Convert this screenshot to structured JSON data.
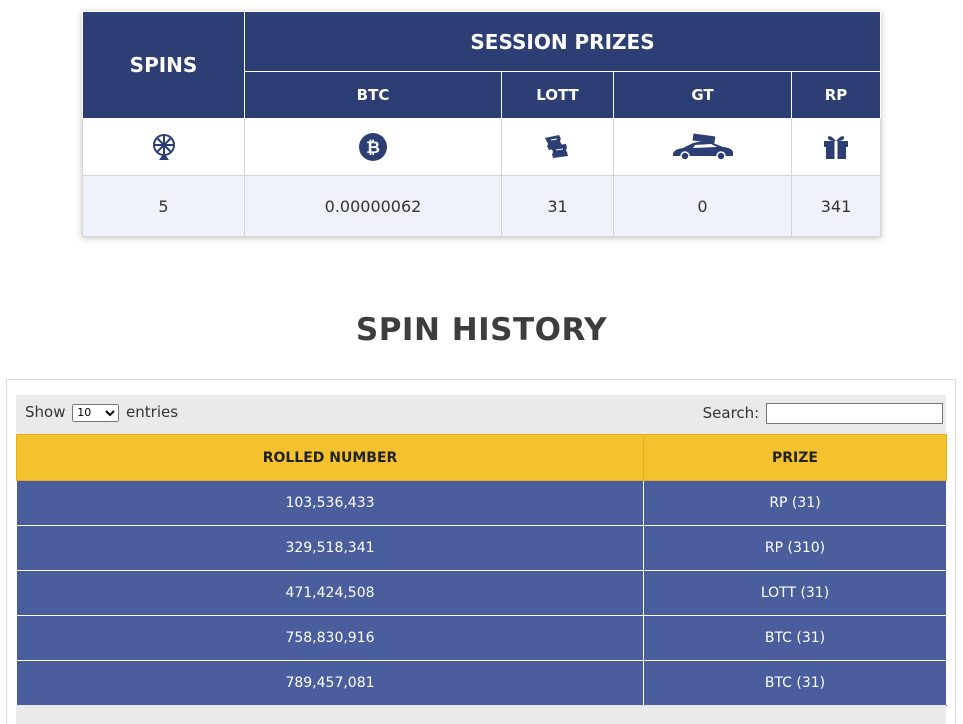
{
  "session": {
    "spins_header": "SPINS",
    "prizes_header": "SESSION PRIZES",
    "columns": [
      "BTC",
      "LOTT",
      "GT",
      "RP"
    ],
    "icons": [
      "wheel-icon",
      "bitcoin-icon",
      "tickets-icon",
      "car-icon",
      "gift-icon"
    ],
    "values": {
      "spins": "5",
      "btc": "0.00000062",
      "lott": "31",
      "gt": "0",
      "rp": "341"
    }
  },
  "history": {
    "title": "SPIN HISTORY",
    "show_label": "Show",
    "entries_value": "10",
    "entries_label": "entries",
    "search_label": "Search:",
    "search_value": "",
    "headers": [
      "ROLLED NUMBER",
      "PRIZE"
    ],
    "rows": [
      {
        "number": "103,536,433",
        "prize": "RP (31)"
      },
      {
        "number": "329,518,341",
        "prize": "RP (310)"
      },
      {
        "number": "471,424,508",
        "prize": "LOTT (31)"
      },
      {
        "number": "758,830,916",
        "prize": "BTC (31)"
      },
      {
        "number": "789,457,081",
        "prize": "BTC (31)"
      }
    ]
  },
  "colors": {
    "header_navy": "#2c3e73",
    "row_blue": "#4a5e9d",
    "header_yellow": "#f4c22f"
  }
}
